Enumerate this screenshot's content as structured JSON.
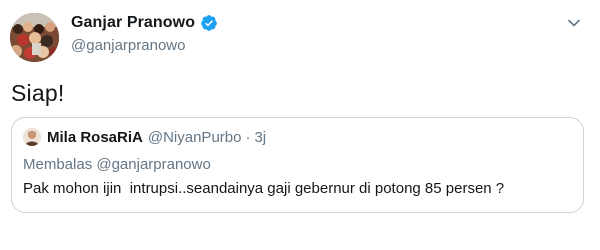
{
  "author": {
    "display_name": "Ganjar Pranowo",
    "handle": "@ganjarpranowo",
    "verified": true
  },
  "tweet": {
    "text": "Siap!"
  },
  "quoted_tweet": {
    "display_name": "Mila RosaRiA",
    "handle": "@NiyanPurbo",
    "separator": "·",
    "time": "3j",
    "reply_context": "Membalas @ganjarpranowo",
    "text": "Pak mohon ijin  intrupsi..seandainya gaji gebernur di potong 85 persen ?"
  },
  "icons": {
    "verified": "verified-badge-icon",
    "menu": "chevron-down-icon"
  },
  "colors": {
    "verified_blue": "#1da1f2",
    "secondary_text": "#657786",
    "primary_text": "#14171a",
    "card_border": "#ccd6dd"
  }
}
